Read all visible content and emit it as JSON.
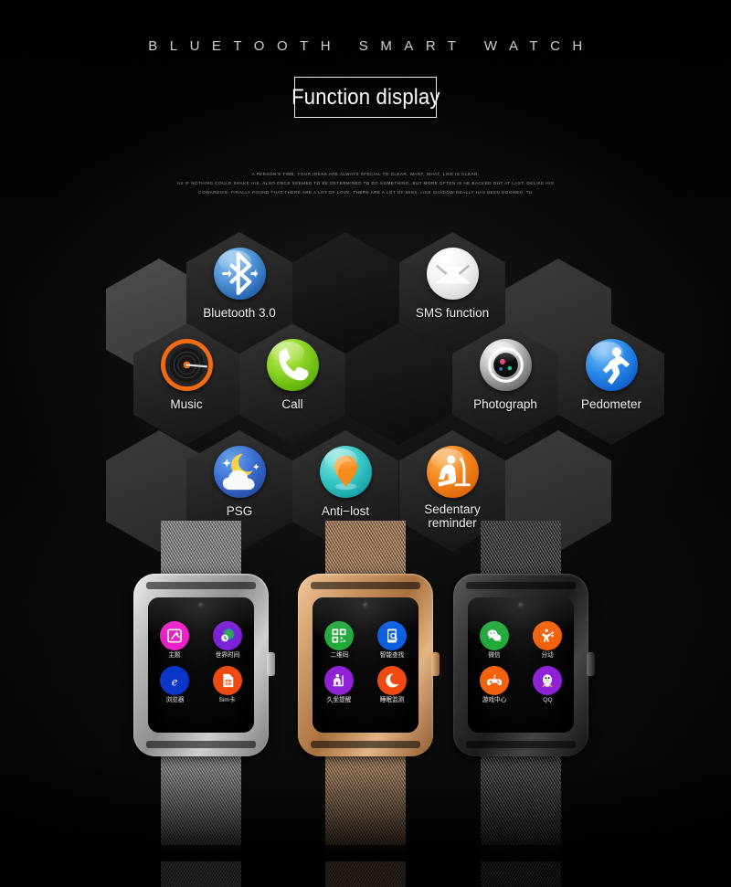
{
  "header": {
    "kicker": "BLUETOOTH  SMART  WATCH",
    "title": "Function display"
  },
  "blurb": {
    "line1": "A PERSON'S TIME, YOUR IDEAS ARE ALWAYS SPECIAL TO CLEAR. WANT, WHAT, LIKE IS CLEAR,",
    "line2": "AS IF NOTHING COULD SHAKE HIS. ALSO ONCE SEEMED TO BE DETERMINED TO DO SOMETHING, BUT MORE OFTEN IS HE BACKED OUT AT LAST. DELIKE HIS",
    "line3": "COWARDICE, FINALLY FOUND THAT THERE ARE A LOT OF LOVE, THERE ARE A LOT OF MISS. LIKE SHADOW REALLY HAS BEEN DOOMED. TH"
  },
  "features": [
    {
      "id": "bluetooth",
      "label": "Bluetooth 3.0",
      "icon": "bluetooth-icon",
      "accent": "#2b6bb5"
    },
    {
      "id": "sms",
      "label": "SMS function",
      "icon": "envelope-icon",
      "accent": "#e8e8e8"
    },
    {
      "id": "music",
      "label": "Music",
      "icon": "vinyl-record-icon",
      "accent": "#f26a21"
    },
    {
      "id": "call",
      "label": "Call",
      "icon": "phone-handset-icon",
      "accent": "#5fb50c"
    },
    {
      "id": "photograph",
      "label": "Photograph",
      "icon": "camera-lens-icon",
      "accent": "#8e8e8e"
    },
    {
      "id": "pedometer",
      "label": "Pedometer",
      "icon": "running-person-icon",
      "accent": "#1565d1"
    },
    {
      "id": "psg",
      "label": "PSG",
      "icon": "moon-stars-cloud-icon",
      "accent": "#3b6fd4"
    },
    {
      "id": "antilost",
      "label": "Anti−lost",
      "icon": "map-pin-icon",
      "accent": "#1da8ad"
    },
    {
      "id": "sedentary",
      "label": "Sedentary reminder",
      "icon": "sitting-person-icon",
      "accent": "#e06b0c"
    }
  ],
  "watches": [
    {
      "id": "silver",
      "color_name": "silver",
      "apps": [
        {
          "name": "主题",
          "icon": "theme-wand-icon",
          "color": "#e920c8"
        },
        {
          "name": "世界时间",
          "icon": "globe-clock-icon",
          "color": "#7b21d6"
        },
        {
          "name": "浏览器",
          "icon": "browser-e-icon",
          "color": "#0b34c9"
        },
        {
          "name": "Sim卡",
          "icon": "sim-card-icon",
          "color": "#f04a13"
        }
      ]
    },
    {
      "id": "gold",
      "color_name": "gold",
      "apps": [
        {
          "name": "二维码",
          "icon": "qr-code-icon",
          "color": "#23a83c"
        },
        {
          "name": "智能查找",
          "icon": "phone-search-icon",
          "color": "#0b5fe0"
        },
        {
          "name": "久坐提醒",
          "icon": "sitting-chair-icon",
          "color": "#8f21d6"
        },
        {
          "name": "睡眠监测",
          "icon": "moon-sleep-icon",
          "color": "#f04a13"
        }
      ]
    },
    {
      "id": "black",
      "color_name": "black",
      "apps": [
        {
          "name": "微信",
          "icon": "wechat-icon",
          "color": "#23a83c"
        },
        {
          "name": "分动",
          "icon": "fitness-people-icon",
          "color": "#f2620d"
        },
        {
          "name": "游戏中心",
          "icon": "gamepad-icon",
          "color": "#f2620d"
        },
        {
          "name": "QQ",
          "icon": "qq-penguin-icon",
          "color": "#8f21d6"
        }
      ]
    }
  ],
  "colors": {
    "background": "#000000",
    "hex_empty": "#4a4a4a",
    "hex_dark": "#262626",
    "text": "#ffffff"
  }
}
